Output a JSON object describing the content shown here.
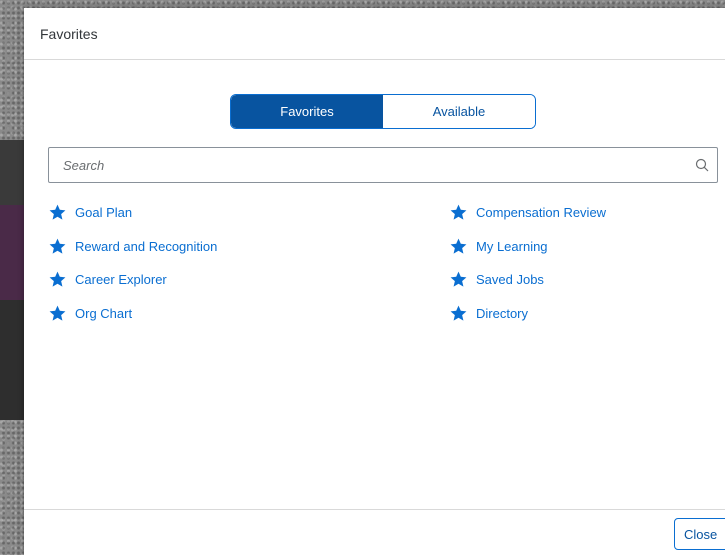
{
  "dialog": {
    "title": "Favorites"
  },
  "tabs": {
    "active": "Favorites",
    "inactive": "Available"
  },
  "search": {
    "placeholder": "Search",
    "value": ""
  },
  "favorites_left": [
    {
      "label": "Goal Plan",
      "icon": "star-icon"
    },
    {
      "label": "Reward and Recognition",
      "icon": "star-icon"
    },
    {
      "label": "Career Explorer",
      "icon": "star-icon"
    },
    {
      "label": "Org Chart",
      "icon": "star-icon"
    }
  ],
  "favorites_right": [
    {
      "label": "Compensation Review",
      "icon": "star-icon"
    },
    {
      "label": "My Learning",
      "icon": "star-icon"
    },
    {
      "label": "Saved Jobs",
      "icon": "star-icon"
    },
    {
      "label": "Directory",
      "icon": "star-icon"
    }
  ],
  "footer": {
    "close_label": "Close"
  },
  "colors": {
    "accent": "#0854a0",
    "link": "#0a6ed1",
    "star": "#0a6ed1"
  }
}
